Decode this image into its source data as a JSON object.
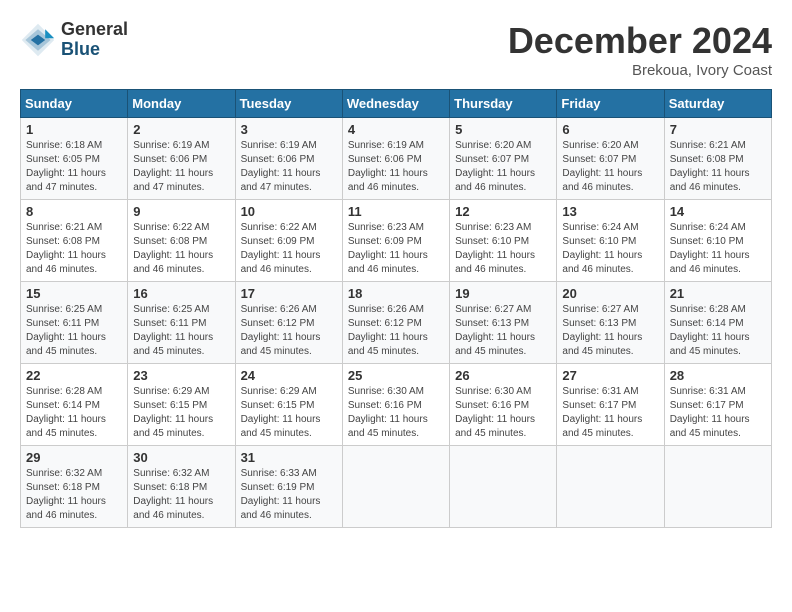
{
  "logo": {
    "general": "General",
    "blue": "Blue"
  },
  "header": {
    "month": "December 2024",
    "location": "Brekoua, Ivory Coast"
  },
  "weekdays": [
    "Sunday",
    "Monday",
    "Tuesday",
    "Wednesday",
    "Thursday",
    "Friday",
    "Saturday"
  ],
  "weeks": [
    [
      {
        "day": "1",
        "info": "Sunrise: 6:18 AM\nSunset: 6:05 PM\nDaylight: 11 hours\nand 47 minutes."
      },
      {
        "day": "2",
        "info": "Sunrise: 6:19 AM\nSunset: 6:06 PM\nDaylight: 11 hours\nand 47 minutes."
      },
      {
        "day": "3",
        "info": "Sunrise: 6:19 AM\nSunset: 6:06 PM\nDaylight: 11 hours\nand 47 minutes."
      },
      {
        "day": "4",
        "info": "Sunrise: 6:19 AM\nSunset: 6:06 PM\nDaylight: 11 hours\nand 46 minutes."
      },
      {
        "day": "5",
        "info": "Sunrise: 6:20 AM\nSunset: 6:07 PM\nDaylight: 11 hours\nand 46 minutes."
      },
      {
        "day": "6",
        "info": "Sunrise: 6:20 AM\nSunset: 6:07 PM\nDaylight: 11 hours\nand 46 minutes."
      },
      {
        "day": "7",
        "info": "Sunrise: 6:21 AM\nSunset: 6:08 PM\nDaylight: 11 hours\nand 46 minutes."
      }
    ],
    [
      {
        "day": "8",
        "info": "Sunrise: 6:21 AM\nSunset: 6:08 PM\nDaylight: 11 hours\nand 46 minutes."
      },
      {
        "day": "9",
        "info": "Sunrise: 6:22 AM\nSunset: 6:08 PM\nDaylight: 11 hours\nand 46 minutes."
      },
      {
        "day": "10",
        "info": "Sunrise: 6:22 AM\nSunset: 6:09 PM\nDaylight: 11 hours\nand 46 minutes."
      },
      {
        "day": "11",
        "info": "Sunrise: 6:23 AM\nSunset: 6:09 PM\nDaylight: 11 hours\nand 46 minutes."
      },
      {
        "day": "12",
        "info": "Sunrise: 6:23 AM\nSunset: 6:10 PM\nDaylight: 11 hours\nand 46 minutes."
      },
      {
        "day": "13",
        "info": "Sunrise: 6:24 AM\nSunset: 6:10 PM\nDaylight: 11 hours\nand 46 minutes."
      },
      {
        "day": "14",
        "info": "Sunrise: 6:24 AM\nSunset: 6:10 PM\nDaylight: 11 hours\nand 46 minutes."
      }
    ],
    [
      {
        "day": "15",
        "info": "Sunrise: 6:25 AM\nSunset: 6:11 PM\nDaylight: 11 hours\nand 45 minutes."
      },
      {
        "day": "16",
        "info": "Sunrise: 6:25 AM\nSunset: 6:11 PM\nDaylight: 11 hours\nand 45 minutes."
      },
      {
        "day": "17",
        "info": "Sunrise: 6:26 AM\nSunset: 6:12 PM\nDaylight: 11 hours\nand 45 minutes."
      },
      {
        "day": "18",
        "info": "Sunrise: 6:26 AM\nSunset: 6:12 PM\nDaylight: 11 hours\nand 45 minutes."
      },
      {
        "day": "19",
        "info": "Sunrise: 6:27 AM\nSunset: 6:13 PM\nDaylight: 11 hours\nand 45 minutes."
      },
      {
        "day": "20",
        "info": "Sunrise: 6:27 AM\nSunset: 6:13 PM\nDaylight: 11 hours\nand 45 minutes."
      },
      {
        "day": "21",
        "info": "Sunrise: 6:28 AM\nSunset: 6:14 PM\nDaylight: 11 hours\nand 45 minutes."
      }
    ],
    [
      {
        "day": "22",
        "info": "Sunrise: 6:28 AM\nSunset: 6:14 PM\nDaylight: 11 hours\nand 45 minutes."
      },
      {
        "day": "23",
        "info": "Sunrise: 6:29 AM\nSunset: 6:15 PM\nDaylight: 11 hours\nand 45 minutes."
      },
      {
        "day": "24",
        "info": "Sunrise: 6:29 AM\nSunset: 6:15 PM\nDaylight: 11 hours\nand 45 minutes."
      },
      {
        "day": "25",
        "info": "Sunrise: 6:30 AM\nSunset: 6:16 PM\nDaylight: 11 hours\nand 45 minutes."
      },
      {
        "day": "26",
        "info": "Sunrise: 6:30 AM\nSunset: 6:16 PM\nDaylight: 11 hours\nand 45 minutes."
      },
      {
        "day": "27",
        "info": "Sunrise: 6:31 AM\nSunset: 6:17 PM\nDaylight: 11 hours\nand 45 minutes."
      },
      {
        "day": "28",
        "info": "Sunrise: 6:31 AM\nSunset: 6:17 PM\nDaylight: 11 hours\nand 45 minutes."
      }
    ],
    [
      {
        "day": "29",
        "info": "Sunrise: 6:32 AM\nSunset: 6:18 PM\nDaylight: 11 hours\nand 46 minutes."
      },
      {
        "day": "30",
        "info": "Sunrise: 6:32 AM\nSunset: 6:18 PM\nDaylight: 11 hours\nand 46 minutes."
      },
      {
        "day": "31",
        "info": "Sunrise: 6:33 AM\nSunset: 6:19 PM\nDaylight: 11 hours\nand 46 minutes."
      },
      {
        "day": "",
        "info": ""
      },
      {
        "day": "",
        "info": ""
      },
      {
        "day": "",
        "info": ""
      },
      {
        "day": "",
        "info": ""
      }
    ]
  ]
}
